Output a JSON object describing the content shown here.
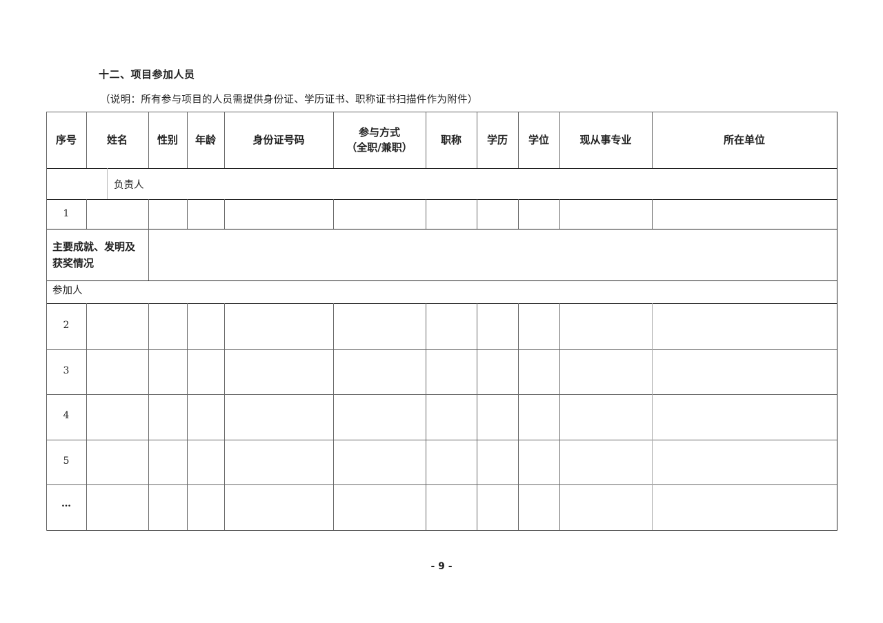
{
  "section_title": "十二、项目参加人员",
  "note": "（说明：所有参与项目的人员需提供身份证、学历证书、职称证书扫描件作为附件）",
  "table": {
    "headers": {
      "seq": "序号",
      "name": "姓名",
      "gender": "性别",
      "age": "年龄",
      "id_number": "身份证号码",
      "participation_line1": "参与方式",
      "participation_line2": "（全职/兼职）",
      "title": "职称",
      "education": "学历",
      "degree": "学位",
      "major": "现从事专业",
      "unit": "所在单位"
    },
    "leader_label": "负责人",
    "leader_row_number": "1",
    "achievements_label_line1": "主要成就、发明及",
    "achievements_label_line2": "获奖情况",
    "participants_label": "参加人",
    "participant_rows": [
      "2",
      "3",
      "4",
      "5",
      "…"
    ]
  },
  "page_number": "- 9 -"
}
